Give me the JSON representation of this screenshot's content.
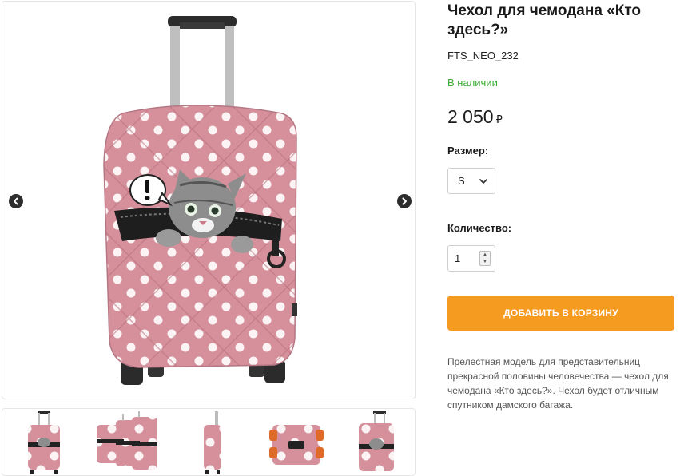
{
  "product": {
    "title": "Чехол для чемодана «Кто здесь?»",
    "sku": "FTS_NEO_232",
    "stock_status": "В наличии",
    "price": "2 050",
    "currency": "₽",
    "description": "Прелестная модель для представительниц прекрасной половины человечества — чехол для чемодана «Кто здесь?». Чехол будет отличным спутником дамского багажа."
  },
  "options": {
    "size_label": "Размер:",
    "size_value": "S",
    "quantity_label": "Количество:",
    "quantity_value": "1"
  },
  "actions": {
    "add_to_cart": "ДОБАВИТЬ В КОРЗИНУ"
  },
  "gallery": {
    "thumbnail_count": 5
  },
  "colors": {
    "accent": "#f59b20",
    "in_stock": "#3aaa35",
    "cover_pink": "#d9929e"
  },
  "icons": {
    "prev": "chevron-left-icon",
    "next": "chevron-right-icon",
    "select": "chevron-down-icon"
  }
}
